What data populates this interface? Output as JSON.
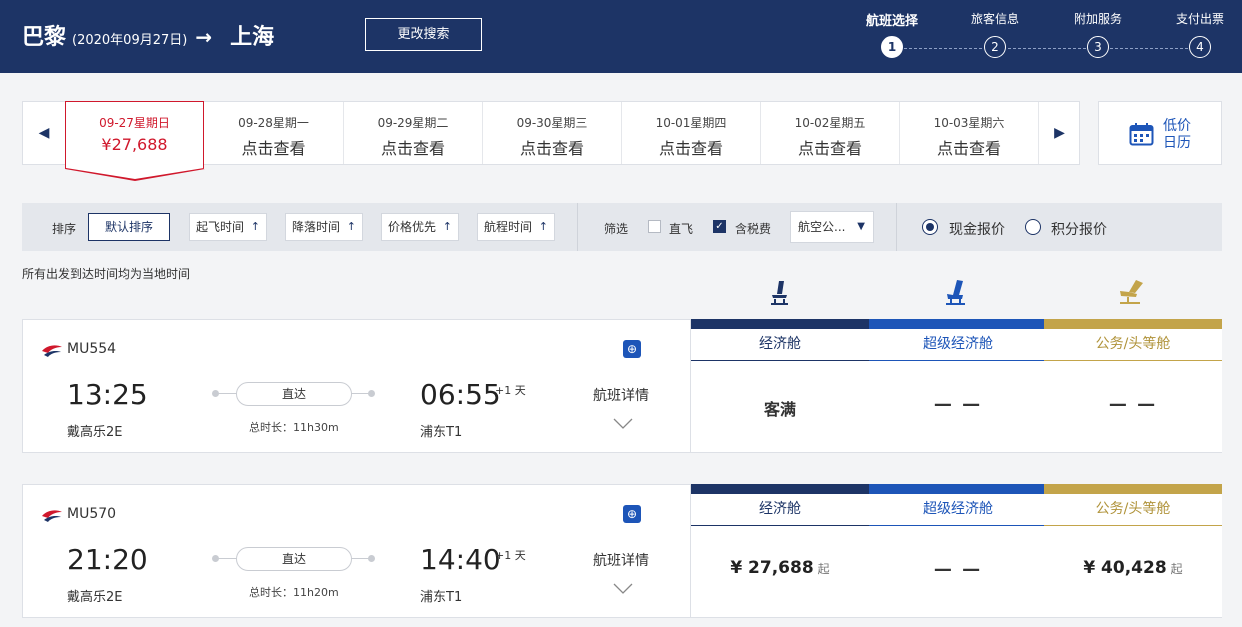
{
  "header": {
    "origin": "巴黎",
    "date": "(2020年09月27日)",
    "arrow": "→",
    "destination": "上海",
    "change_search": "更改搜索",
    "steps": [
      {
        "label": "航班选择",
        "num": "1"
      },
      {
        "label": "旅客信息",
        "num": "2"
      },
      {
        "label": "附加服务",
        "num": "3"
      },
      {
        "label": "支付出票",
        "num": "4"
      }
    ]
  },
  "date_bar": {
    "cells": [
      {
        "date": "09-27星期日",
        "price": "¥27,688"
      },
      {
        "date": "09-28星期一",
        "price": "点击查看"
      },
      {
        "date": "09-29星期二",
        "price": "点击查看"
      },
      {
        "date": "09-30星期三",
        "price": "点击查看"
      },
      {
        "date": "10-01星期四",
        "price": "点击查看"
      },
      {
        "date": "10-02星期五",
        "price": "点击查看"
      },
      {
        "date": "10-03星期六",
        "price": "点击查看"
      }
    ],
    "calendar_line1": "低价",
    "calendar_line2": "日历"
  },
  "filters": {
    "sort_label": "排序",
    "default_sort": "默认排序",
    "departure_time": "起飞时间",
    "arrival_time": "降落时间",
    "price_first": "价格优先",
    "duration": "航程时间",
    "filter_label": "筛选",
    "direct": "直飞",
    "tax_included": "含税费",
    "airline_select": "航空公...",
    "cash_price": "现金报价",
    "points_price": "积分报价"
  },
  "note": "所有出发到达时间均为当地时间",
  "cabins": {
    "economy": "经济舱",
    "premium_economy": "超级经济舱",
    "business_first": "公务/头等舱"
  },
  "colors": {
    "navy": "#1d3466",
    "blue": "#1d55b8",
    "gold": "#c3a44a",
    "red": "#d0182c"
  },
  "flights": [
    {
      "number": "MU554",
      "dep_time": "13:25",
      "dep_airport": "戴高乐2E",
      "arr_time": "06:55",
      "day_offset": "+1 天",
      "arr_airport": "浦东T1",
      "stop": "直达",
      "duration": "总时长：11h30m",
      "detail": "航班详情",
      "economy": "客满",
      "premium": "— —",
      "business": "— —"
    },
    {
      "number": "MU570",
      "dep_time": "21:20",
      "dep_airport": "戴高乐2E",
      "arr_time": "14:40",
      "day_offset": "+1 天",
      "arr_airport": "浦东T1",
      "stop": "直达",
      "duration": "总时长：11h20m",
      "detail": "航班详情",
      "economy": "¥ 27,688",
      "economy_suffix": "起",
      "premium": "— —",
      "business": "¥ 40,428",
      "business_suffix": "起"
    }
  ]
}
